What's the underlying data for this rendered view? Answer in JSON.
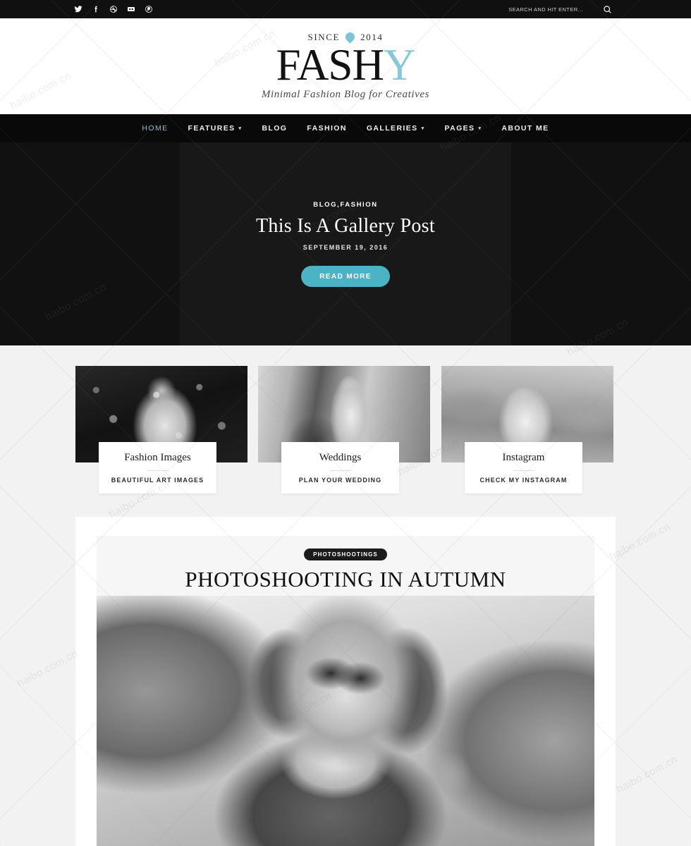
{
  "topbar": {
    "socials": [
      {
        "name": "twitter-icon",
        "label": "Twitter"
      },
      {
        "name": "facebook-icon",
        "label": "Facebook"
      },
      {
        "name": "dribbble-icon",
        "label": "Dribbble"
      },
      {
        "name": "flickr-icon",
        "label": "Flickr"
      },
      {
        "name": "pinterest-icon",
        "label": "Pinterest"
      }
    ],
    "search": {
      "placeholder": "SEARCH AND HIT ENTER...",
      "value": ""
    }
  },
  "logo": {
    "since_label": "SINCE",
    "since_year": "2014",
    "brand_dark": "FASH",
    "brand_accent": "Y",
    "tagline": "Minimal Fashion Blog for Creatives"
  },
  "nav": {
    "items": [
      {
        "label": "HOME",
        "has_caret": false,
        "active": true
      },
      {
        "label": "FEATURES",
        "has_caret": true,
        "active": false
      },
      {
        "label": "BLOG",
        "has_caret": false,
        "active": false
      },
      {
        "label": "FASHION",
        "has_caret": false,
        "active": false
      },
      {
        "label": "GALLERIES",
        "has_caret": true,
        "active": false
      },
      {
        "label": "PAGES",
        "has_caret": true,
        "active": false
      },
      {
        "label": "ABOUT ME",
        "has_caret": false,
        "active": false
      }
    ],
    "caret_glyph": "▾"
  },
  "hero": {
    "category": "BLOG,FASHION",
    "title": "This Is A Gallery Post",
    "date": "SEPTEMBER 19, 2016",
    "button_label": "READ MORE"
  },
  "cards": [
    {
      "title": "Fashion Images",
      "subtitle": "BEAUTIFUL ART IMAGES"
    },
    {
      "title": "Weddings",
      "subtitle": "PLAN YOUR WEDDING"
    },
    {
      "title": "Instagram",
      "subtitle": "CHECK MY INSTAGRAM"
    }
  ],
  "post": {
    "badge": "PHOTOSHOOTINGS",
    "title": "PHOTOSHOOTING IN AUTUMN"
  },
  "watermark": {
    "text": "haibo.com.cn"
  },
  "colors": {
    "accent_teal": "#4bb3c4",
    "logo_accent": "#8cc7d8",
    "nav_active": "#7bc4d7",
    "dark_bar": "#0a0909",
    "hero_bg": "#121111",
    "page_bg": "#f2f2f2"
  }
}
